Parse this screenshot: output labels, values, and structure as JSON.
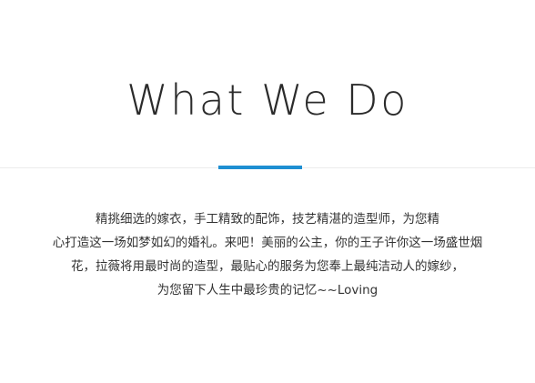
{
  "section": {
    "title": "What We Do",
    "accent_color": "#1e8fd2",
    "description_lines": [
      "精挑细选的嫁衣，手工精致的配饰，技艺精湛的造型师，为您精",
      "心打造这一场如梦如幻的婚礼。来吧！美丽的公主，你的王子许你这一场盛世烟",
      "花，拉薇将用最时尚的造型，最贴心的服务为您奉上最纯洁动人的嫁纱，",
      "为您留下人生中最珍贵的记忆~~Loving"
    ]
  }
}
